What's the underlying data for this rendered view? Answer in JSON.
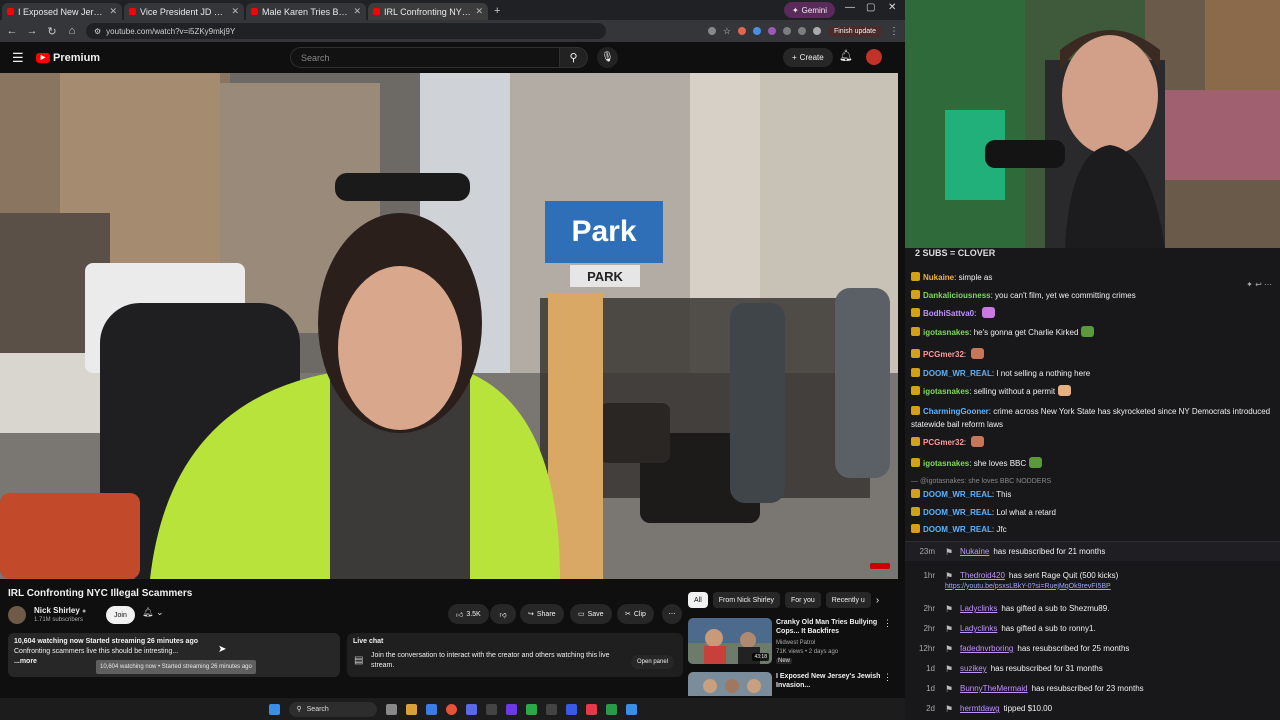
{
  "browser": {
    "tabs": [
      {
        "title": "I Exposed New Jersey's Jewish"
      },
      {
        "title": "Vice President JD Vance Delive"
      },
      {
        "title": "Male Karen Tries Bullying Offic"
      },
      {
        "title": "IRL Confronting NYC Illegal"
      }
    ],
    "gemini_label": "Gemini",
    "url": "youtube.com/watch?v=i5ZKy9mkj9Y",
    "finish_update": "Finish update"
  },
  "youtube": {
    "logo_text": "Premium",
    "search_placeholder": "Search",
    "create_label": "Create",
    "video": {
      "title": "IRL Confronting NYC Illegal Scammers",
      "sign_park": "Park",
      "sign_park2": "PARK"
    },
    "channel": {
      "name": "Nick Shirley",
      "subscribers": "1.71M subscribers",
      "join_label": "Join"
    },
    "actions": {
      "likes": "3.5K",
      "share": "Share",
      "save": "Save",
      "clip": "Clip"
    },
    "description": {
      "stats": "10,604 watching now  Started streaming 26 minutes ago",
      "text": "Confronting scammers live this should be intresting...",
      "more": "...more",
      "tooltip": "10,604 watching now • Started streaming 26 minutes ago"
    },
    "live_chat": {
      "title": "Live chat",
      "text": "Join the conversation to interact with the creator and others watching this live stream.",
      "open_panel": "Open panel"
    },
    "chips": [
      "All",
      "From Nick Shirley",
      "For you",
      "Recently u"
    ],
    "recommendations": [
      {
        "title": "Cranky Old Man Tries Bullying Cops... It Backfires",
        "channel": "Midwest Patrol",
        "meta": "71K views • 2 days ago",
        "badge": "New",
        "duration": "43:18"
      },
      {
        "title": "I Exposed New Jersey's Jewish Invasion...",
        "channel": "",
        "meta": "",
        "badge": "",
        "duration": ""
      }
    ]
  },
  "taskbar": {
    "search_label": "Search"
  },
  "stream_chat": {
    "header": "2 SUBS = CLOVER",
    "messages": [
      {
        "user": "Nukaine",
        "color": "#f0b23e",
        "text": "simple as",
        "emote": ""
      },
      {
        "user": "Dankaliciousness",
        "color": "#7ed957",
        "text": "you can't film, yet we committing crimes",
        "emote": ""
      },
      {
        "user": "BodhiSattva0",
        "color": "#bf94ff",
        "text": "",
        "emote": "#c87ae0"
      },
      {
        "user": "igotasnakes",
        "color": "#7ed957",
        "text": "he's gonna get Charlie Kirked",
        "emote": "#5a9a3a"
      },
      {
        "user": "PCGmer32",
        "color": "#ff9a9a",
        "text": "",
        "emote": "#c8765a"
      },
      {
        "user": "DOOM_WR_REAL",
        "color": "#5ab4ff",
        "text": "I not selling a nothing here",
        "emote": ""
      },
      {
        "user": "igotasnakes",
        "color": "#7ed957",
        "text": "selling without a permit",
        "emote": "#e8b080"
      },
      {
        "user": "CharmingGooner",
        "color": "#5ab4ff",
        "text": "crime across New York State has skyrocketed since NY Democrats introduced statewide bail reform laws",
        "emote": ""
      },
      {
        "user": "PCGmer32",
        "color": "#ff9a9a",
        "text": "",
        "emote": "#c8765a"
      },
      {
        "user": "igotasnakes",
        "color": "#7ed957",
        "text": "she loves BBC",
        "emote": "#5a9a3a"
      }
    ],
    "reply_context": "@igotasnakes: she loves BBC NODDERS",
    "messages2": [
      {
        "user": "DOOM_WR_REAL",
        "color": "#5ab4ff",
        "text": "This"
      },
      {
        "user": "DOOM_WR_REAL",
        "color": "#5ab4ff",
        "text": "Lol what a retard"
      },
      {
        "user": "DOOM_WR_REAL",
        "color": "#5ab4ff",
        "text": "Jfc"
      }
    ],
    "events": [
      {
        "time": "23m",
        "name": "Nukaine",
        "text": "has resubscribed for 21 months"
      },
      {
        "time": "1hr",
        "name": "Thedroid420",
        "text": "has sent Rage Quit (500 kicks)",
        "link": "https://youtu.be/psxsLBkY-0?si=RuejMqOk9revFI5BP"
      },
      {
        "time": "2hr",
        "name": "Ladyclinks",
        "text": "has gifted a sub to Shezmu89."
      },
      {
        "time": "2hr",
        "name": "Ladyclinks",
        "text": "has gifted a sub to ronny1."
      },
      {
        "time": "12hr",
        "name": "fadednvrboring",
        "text": "has resubscribed for 25 months"
      },
      {
        "time": "1d",
        "name": "suzikey",
        "text": "has resubscribed for 31 months"
      },
      {
        "time": "1d",
        "name": "BunnyTheMermaid",
        "text": "has resubscribed for 23 months"
      },
      {
        "time": "2d",
        "name": "hermtdawg",
        "text": "tipped $10.00"
      }
    ]
  }
}
